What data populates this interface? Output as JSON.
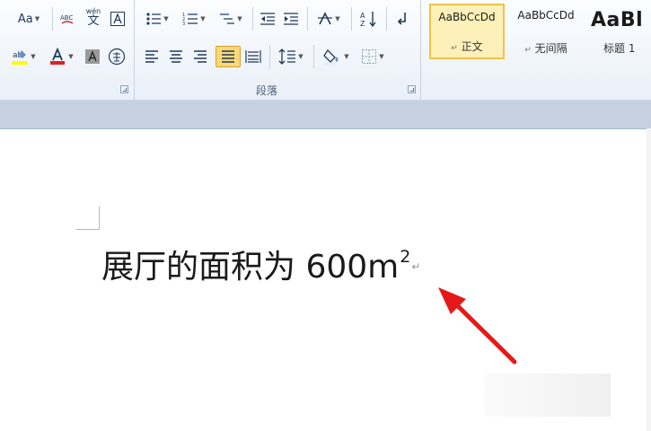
{
  "ribbon": {
    "font_group": {
      "change_case_label": "Aa",
      "phonetic_guide_text": "wén",
      "phonetic_guide_char": "文"
    },
    "paragraph_group": {
      "label": "段落"
    },
    "styles_group": {
      "styles": [
        {
          "sample": "AaBbCcDd",
          "name": "正文",
          "selected": true
        },
        {
          "sample": "AaBbCcDd",
          "name": "无间隔",
          "selected": false
        },
        {
          "sample": "AaBl",
          "name": "标题 1",
          "selected": false
        }
      ],
      "paragraph_mark_glyph": "↵"
    }
  },
  "document": {
    "text": "展厅的面积为 600m",
    "superscript": "2",
    "paragraph_mark": "↵"
  },
  "colors": {
    "highlight_yellow": "#ffff00",
    "font_red": "#e02020",
    "arrow_red": "#e41a1a",
    "selected_button": "#fbd978"
  },
  "icons": [
    "change-case-icon",
    "phonetic-guide-icon",
    "character-border-icon",
    "bullets-icon",
    "numbering-icon",
    "multilevel-list-icon",
    "decrease-indent-icon",
    "increase-indent-icon",
    "chinese-layout-icon",
    "sort-icon",
    "show-marks-icon",
    "highlight-icon",
    "font-color-icon",
    "character-shading-icon",
    "enclose-characters-icon",
    "align-left-icon",
    "center-icon",
    "align-right-icon",
    "justify-icon",
    "distributed-icon",
    "line-spacing-icon",
    "shading-icon",
    "borders-icon",
    "dialog-launcher-icon"
  ]
}
